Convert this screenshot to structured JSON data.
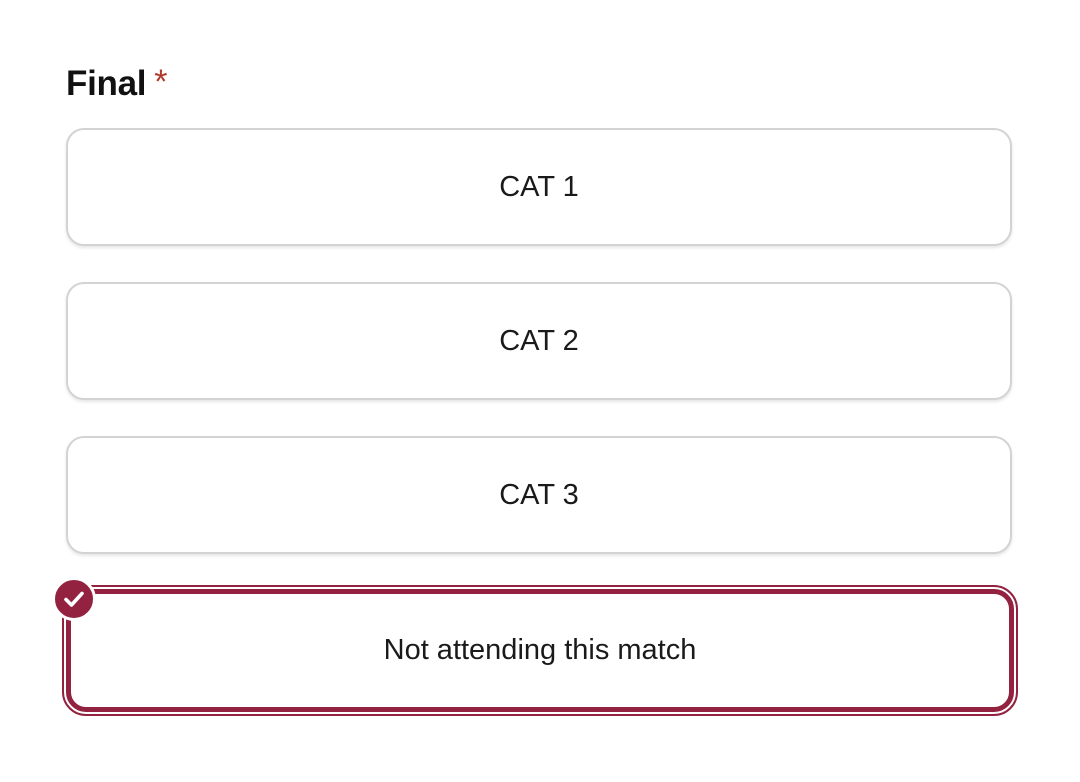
{
  "question": {
    "label": "Final",
    "required_mark": "*"
  },
  "options": [
    {
      "label": "CAT 1",
      "selected": false
    },
    {
      "label": "CAT 2",
      "selected": false
    },
    {
      "label": "CAT 3",
      "selected": false
    },
    {
      "label": "Not attending this match",
      "selected": true
    }
  ],
  "colors": {
    "accent": "#92223f",
    "required": "#b03a2e",
    "border": "#d3d3d3"
  },
  "icons": {
    "selected_badge": "checkmark-icon"
  }
}
